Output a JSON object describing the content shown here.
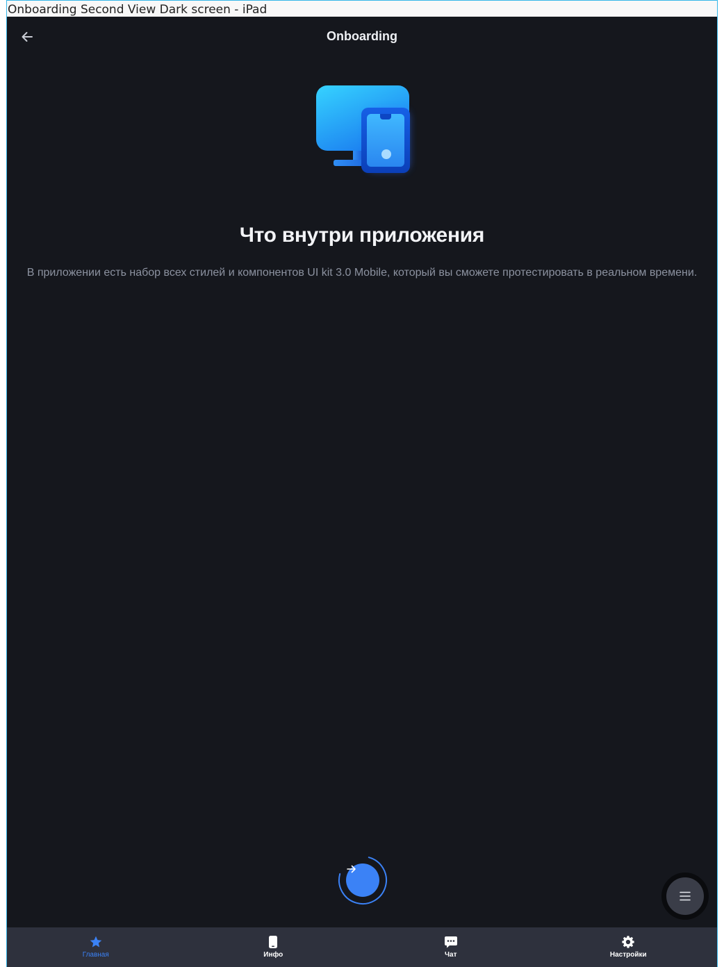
{
  "window": {
    "title": "Onboarding Second View Dark screen - iPad"
  },
  "navbar": {
    "title": "Onboarding",
    "back_icon": "arrow-left-icon"
  },
  "hero": {
    "icon": "devices-icon"
  },
  "content": {
    "headline": "Что внутри приложения",
    "description": "В приложении есть набор всех стилей и компонентов UI kit 3.0 Mobile, который вы сможете протестировать в реальном времени."
  },
  "next_button": {
    "icon": "arrow-right-icon",
    "progress": 0.75
  },
  "fab": {
    "icon": "menu-icon"
  },
  "tabbar": {
    "items": [
      {
        "label": "Главная",
        "icon": "star-icon",
        "active": true
      },
      {
        "label": "Инфо",
        "icon": "phone-icon",
        "active": false
      },
      {
        "label": "Чат",
        "icon": "chat-icon",
        "active": false
      },
      {
        "label": "Настройки",
        "icon": "gear-icon",
        "active": false
      }
    ]
  },
  "colors": {
    "background": "#15171d",
    "accent": "#3b82f6",
    "tabbar": "#2e313d",
    "text_primary": "#f2f3f6",
    "text_secondary": "#8c92a0"
  }
}
